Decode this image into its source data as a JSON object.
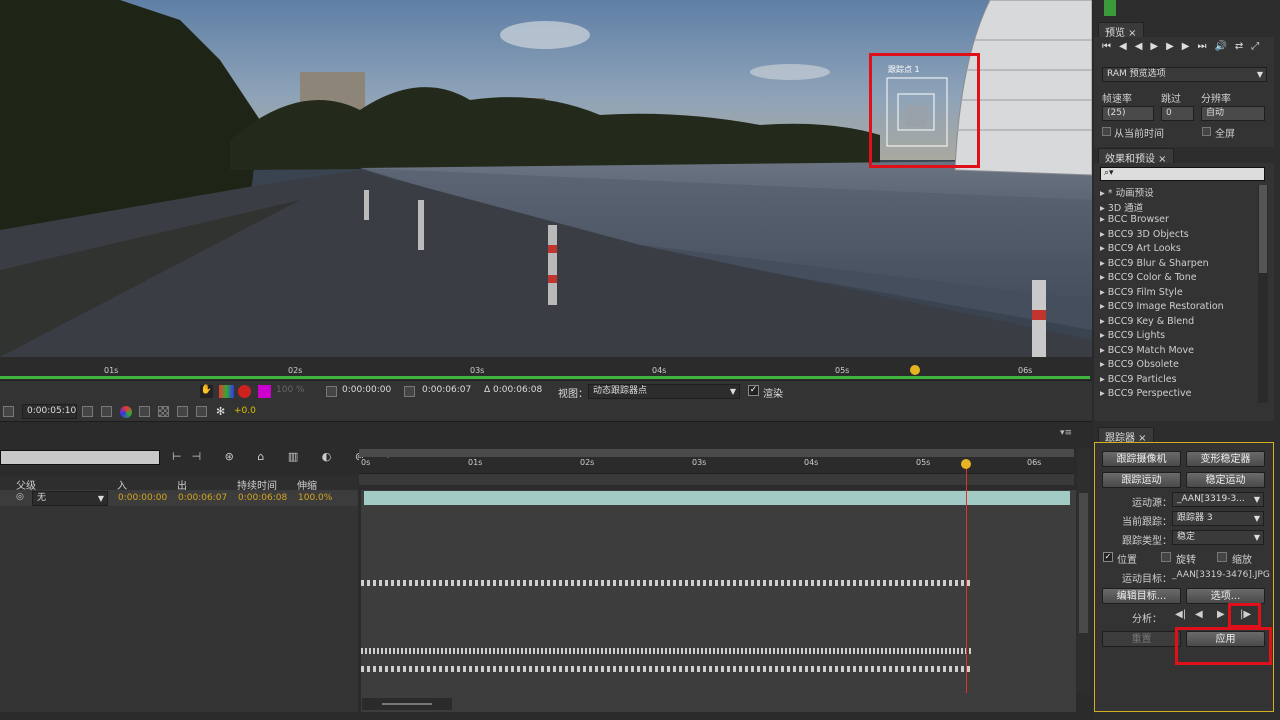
{
  "app": "After Effects",
  "viewer": {
    "track_point_label": "跟踪点 1"
  },
  "ruler": {
    "ticks": [
      "01s",
      "02s",
      "03s",
      "04s",
      "05s",
      "06s"
    ]
  },
  "view_controls": {
    "zoom_pct": "100 %",
    "time_start": "0:00:00:00",
    "time_end": "0:00:06:07",
    "duration": "Δ 0:00:06:08",
    "view_label": "视图：",
    "view_value": "动态跟踪器点",
    "render_label": "渲染",
    "current_time": "0:00:05:10",
    "exposure": "+0.0"
  },
  "timeline": {
    "ruler_ticks": [
      "0s",
      "01s",
      "02s",
      "03s",
      "04s",
      "05s",
      "06s"
    ],
    "columns": [
      "父级",
      "入",
      "出",
      "持续时间",
      "伸缩"
    ],
    "layer": {
      "parent": "无",
      "in": "0:00:00:00",
      "out": "0:00:06:07",
      "duration": "0:00:06:08",
      "stretch": "100.0%"
    }
  },
  "preview": {
    "title": "预览",
    "ram_options": "RAM 预览选项",
    "fps_label": "帧速率",
    "skip_label": "跳过",
    "resolution_label": "分辨率",
    "fps_value": "(25)",
    "skip_value": "0",
    "resolution_value": "自动",
    "from_current": "从当前时间",
    "fullscreen": "全屏"
  },
  "effects": {
    "title": "效果和预设",
    "search_placeholder": "",
    "items": [
      "* 动画预设",
      "3D 通道",
      "BCC Browser",
      "BCC9 3D Objects",
      "BCC9 Art Looks",
      "BCC9 Blur & Sharpen",
      "BCC9 Color & Tone",
      "BCC9 Film Style",
      "BCC9 Image Restoration",
      "BCC9 Key & Blend",
      "BCC9 Lights",
      "BCC9 Match Move",
      "BCC9 Obsolete",
      "BCC9 Particles",
      "BCC9 Perspective"
    ]
  },
  "tracker": {
    "title": "跟踪器",
    "track_camera": "跟踪摄像机",
    "warp_stabilizer": "变形稳定器",
    "track_motion": "跟踪运动",
    "stabilize_motion": "稳定运动",
    "motion_source_label": "运动源：",
    "motion_source_value": "_AAN[3319-3...",
    "current_track_label": "当前跟踪：",
    "current_track_value": "跟踪器 3",
    "track_type_label": "跟踪类型：",
    "track_type_value": "稳定",
    "position": "位置",
    "rotation": "旋转",
    "scale": "缩放",
    "motion_target_label": "运动目标：",
    "motion_target_value": "_AAN[3319-3476].JPG",
    "edit_target": "编辑目标...",
    "options": "选项...",
    "analyze_label": "分析：",
    "reset": "重置",
    "apply": "应用"
  }
}
